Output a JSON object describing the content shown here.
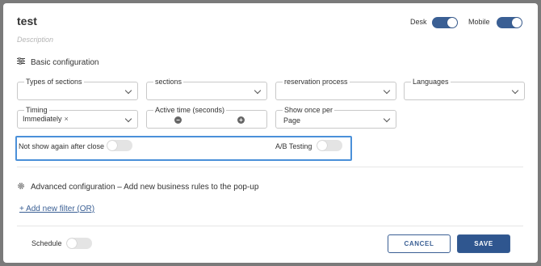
{
  "header": {
    "title": "test",
    "description_placeholder": "Description",
    "desk_label": "Desk",
    "mobile_label": "Mobile",
    "desk_on": true,
    "mobile_on": true
  },
  "basic": {
    "heading": "Basic configuration",
    "icon": "sliders-icon",
    "fields": {
      "types_of_sections": {
        "label": "Types of sections",
        "value": ""
      },
      "sections": {
        "label": "sections",
        "value": ""
      },
      "reservation_process": {
        "label": "reservation process",
        "value": ""
      },
      "languages": {
        "label": "Languages",
        "value": ""
      },
      "timing": {
        "label": "Timing",
        "chip": "Immediately",
        "chip_remove": "×"
      },
      "active_time": {
        "label": "Active time (seconds)",
        "minus": "−",
        "plus": "+"
      },
      "show_once_per": {
        "label": "Show once per",
        "value": "Page"
      }
    },
    "not_show_again": {
      "label": "Not show again after close",
      "on": false
    },
    "ab_testing": {
      "label": "A/B Testing",
      "on": false
    }
  },
  "advanced": {
    "heading": "Advanced configuration – Add new business rules to the pop-up",
    "icon": "gear-icon",
    "add_filter_link": "+ Add new filter (OR)"
  },
  "footer": {
    "schedule_label": "Schedule",
    "schedule_on": false,
    "cancel_label": "CANCEL",
    "save_label": "SAVE"
  },
  "colors": {
    "accent": "#2f568f",
    "highlight_border": "#4a90d9"
  }
}
